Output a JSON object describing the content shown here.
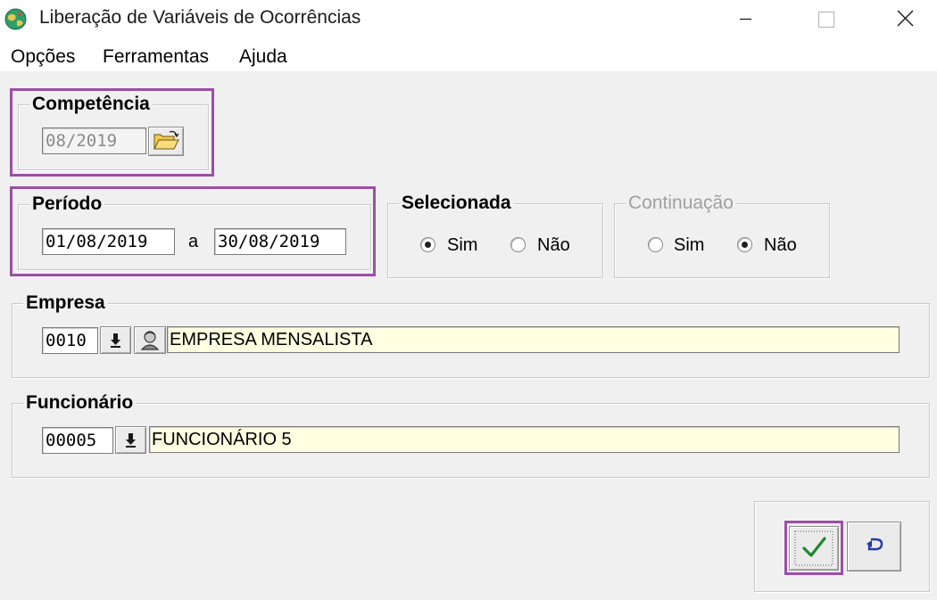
{
  "window": {
    "title": "Liberação de Variáveis de Ocorrências",
    "icon": "globe-app-icon",
    "controls": [
      "minimize-icon",
      "maximize-icon",
      "close-icon"
    ]
  },
  "menu": {
    "items": [
      "Opções",
      "Ferramentas",
      "Ajuda"
    ]
  },
  "competencia": {
    "label": "Competência",
    "value": "08/2019",
    "button_icon": "open-folder-icon"
  },
  "periodo": {
    "label": "Período",
    "start": "01/08/2019",
    "separator": "a",
    "end": "30/08/2019"
  },
  "selecionada": {
    "label": "Selecionada",
    "options": [
      "Sim",
      "Não"
    ],
    "selected": "Sim"
  },
  "continuacao": {
    "label": "Continuação",
    "enabled": false,
    "options": [
      "Sim",
      "Não"
    ],
    "selected": "Não"
  },
  "empresa": {
    "label": "Empresa",
    "code": "0010",
    "name": "EMPRESA MENSALISTA",
    "lookup_icon": "arrow-down-icon",
    "person_icon": "person-icon"
  },
  "funcionario": {
    "label": "Funcionário",
    "code": "00005",
    "name": "FUNCIONÁRIO 5",
    "lookup_icon": "arrow-down-icon"
  },
  "actions": {
    "confirm_icon": "checkmark-icon",
    "undo_icon": "undo-icon"
  },
  "colors": {
    "highlight": "#9b4fa5",
    "name_field_bg": "#ffffe1",
    "confirm_check": "#1e8a2e",
    "undo_arrow": "#1f3aa8"
  }
}
